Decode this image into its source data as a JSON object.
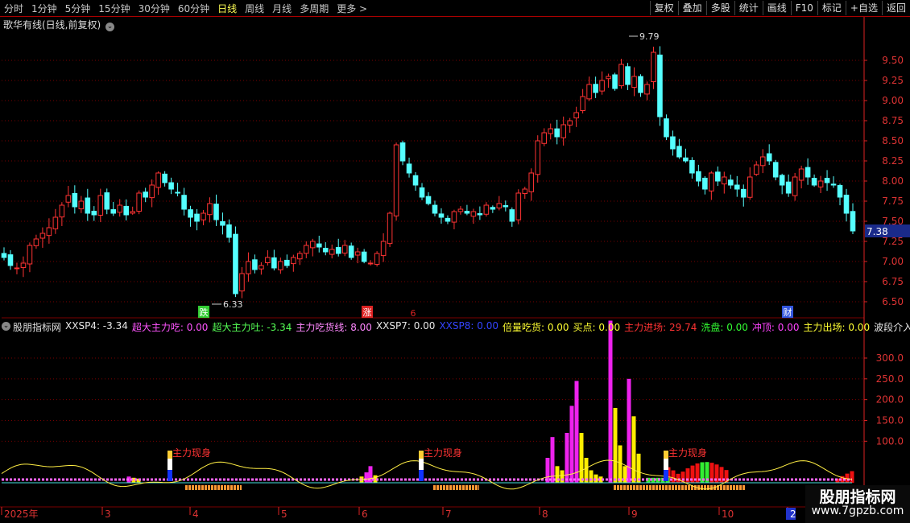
{
  "toolbar": {
    "periods": [
      "分时",
      "1分钟",
      "5分钟",
      "15分钟",
      "30分钟",
      "60分钟",
      "日线",
      "周线",
      "月线",
      "多周期",
      "更多 >"
    ],
    "active_period": "日线",
    "actions": [
      "复权",
      "叠加",
      "多股",
      "统计",
      "画线",
      "F10",
      "标记",
      "+自选",
      "返回"
    ]
  },
  "main_title": "歌华有线(日线,前复权)",
  "indicator": {
    "name": "股朋指标网",
    "fields": [
      {
        "text": "XXSP4: -3.34",
        "color": "#e8e8e8"
      },
      {
        "text": "超大主力吃: 0.00",
        "color": "#ff55ff"
      },
      {
        "text": "超大主力吐: -3.34",
        "color": "#55ff55"
      },
      {
        "text": "主力吃货线: 8.00",
        "color": "#ff88ff"
      },
      {
        "text": "XXSP7: 0.00",
        "color": "#e8e8e8"
      },
      {
        "text": "XXSP8: 0.00",
        "color": "#3344ff"
      },
      {
        "text": "倍量吃货: 0.00",
        "color": "#ffff33"
      },
      {
        "text": "买点: 0.00",
        "color": "#ffff33"
      },
      {
        "text": "主力进场: 29.74",
        "color": "#ff3333"
      },
      {
        "text": "洗盘: 0.00",
        "color": "#33ff33"
      },
      {
        "text": "冲顶: 0.00",
        "color": "#ff44ff"
      },
      {
        "text": "主力出场: 0.00",
        "color": "#ffff33"
      },
      {
        "text": "波段介入",
        "color": "#e8e8e8"
      }
    ]
  },
  "price_axis": [
    "9.50",
    "9.25",
    "9.00",
    "8.75",
    "8.50",
    "8.25",
    "8.00",
    "7.75",
    "7.50",
    "7.25",
    "7.00",
    "6.75",
    "6.50"
  ],
  "current_price": "7.38",
  "high_label": "9.79",
  "low_label": "6.33",
  "volume_axis": [
    "300.0",
    "250.0",
    "200.0",
    "150.0",
    "100.0"
  ],
  "date_axis": [
    "2025年",
    "3",
    "4",
    "5",
    "6",
    "7",
    "8",
    "9",
    "10",
    "2"
  ],
  "badges": [
    {
      "text": "跌",
      "color": "#33cc33"
    },
    {
      "text": "涨",
      "color": "#dd2222"
    },
    {
      "text": "财",
      "color": "#3355dd"
    }
  ],
  "small_mark": "6",
  "signal_text": "主力现身",
  "watermark": {
    "title": "股朋指标网",
    "url": "www.7gpzb.com"
  },
  "colors": {
    "up": "#ff3333",
    "down": "#55ffff",
    "grid": "#7a0000",
    "axis": "#dd2222"
  },
  "chart_data": {
    "type": "candlestick",
    "price_range": [
      6.3,
      9.85
    ],
    "closes": [
      7.05,
      6.95,
      6.92,
      6.98,
      7.2,
      7.28,
      7.35,
      7.42,
      7.55,
      7.7,
      7.82,
      7.68,
      7.75,
      7.6,
      7.58,
      7.82,
      7.65,
      7.6,
      7.7,
      7.58,
      7.62,
      7.85,
      7.8,
      7.95,
      8.1,
      7.98,
      7.9,
      7.85,
      7.65,
      7.55,
      7.5,
      7.6,
      7.72,
      7.52,
      7.45,
      7.3,
      6.6,
      6.85,
      7.0,
      6.9,
      6.95,
      7.05,
      6.92,
      7.0,
      6.95,
      7.05,
      7.1,
      7.2,
      7.25,
      7.18,
      7.12,
      7.15,
      7.1,
      7.2,
      7.05,
      7.12,
      7.0,
      6.98,
      7.1,
      7.25,
      7.6,
      8.45,
      8.25,
      8.1,
      7.95,
      7.8,
      7.72,
      7.6,
      7.55,
      7.5,
      7.62,
      7.65,
      7.6,
      7.62,
      7.58,
      7.7,
      7.65,
      7.72,
      7.68,
      7.5,
      7.85,
      7.9,
      8.1,
      8.5,
      8.6,
      8.65,
      8.55,
      8.7,
      8.75,
      8.85,
      9.05,
      9.2,
      9.1,
      9.25,
      9.3,
      9.15,
      9.45,
      9.2,
      9.3,
      9.1,
      9.2,
      9.6,
      8.8,
      8.55,
      8.4,
      8.3,
      8.25,
      8.1,
      8.0,
      7.9,
      8.1,
      8.0,
      8.05,
      7.95,
      7.9,
      7.8,
      8.05,
      8.2,
      8.3,
      8.25,
      8.05,
      7.95,
      7.85,
      8.05,
      8.15,
      8.05,
      7.95,
      8.0,
      7.98,
      7.95,
      7.8,
      7.6,
      7.38
    ]
  }
}
